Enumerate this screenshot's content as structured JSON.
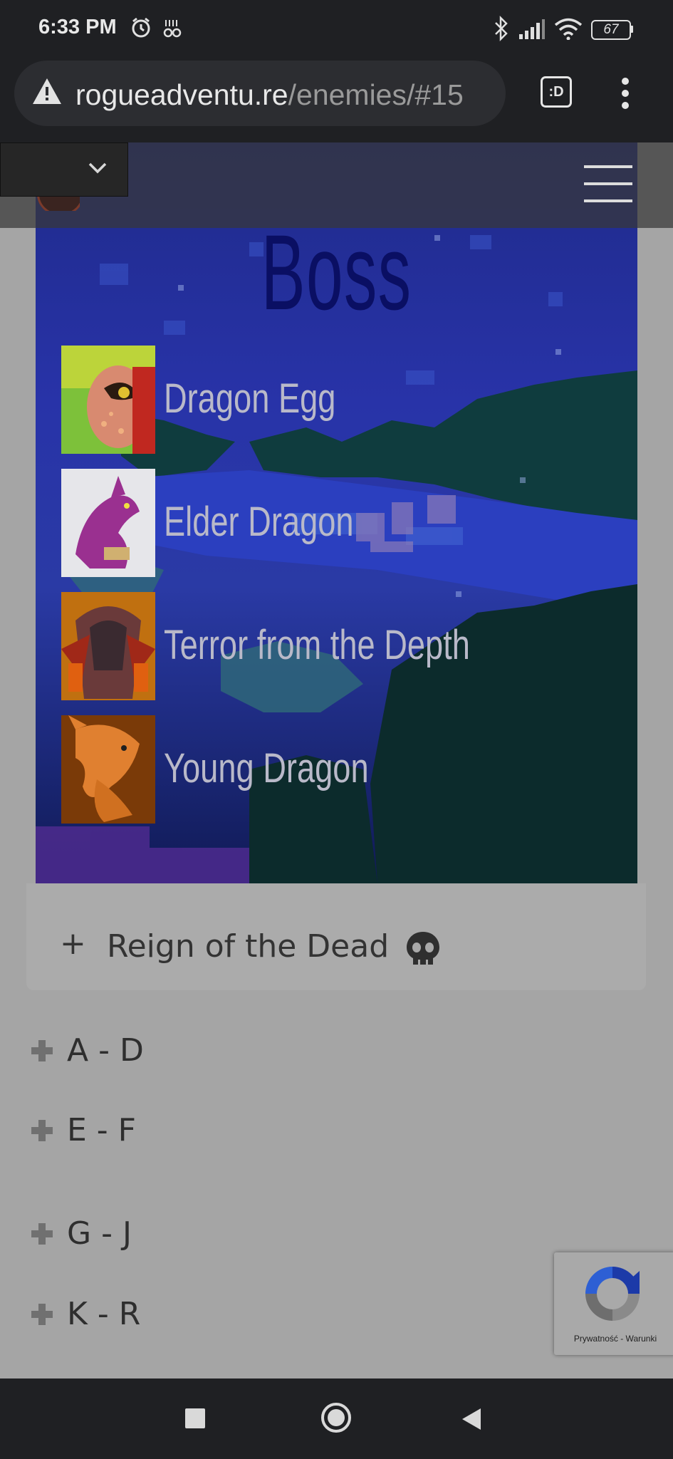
{
  "status_bar": {
    "time": "6:33 PM",
    "battery": "67",
    "icons": [
      "alarm-icon",
      "data-saver-icon",
      "bluetooth-icon",
      "signal-icon",
      "wifi-icon",
      "battery-icon"
    ]
  },
  "browser": {
    "url_domain": "rogueadventu.re",
    "url_path": "/enemies/#15",
    "tab_count": ":D",
    "icons": [
      "warning-icon",
      "tab-switcher-icon",
      "more-vert-icon"
    ]
  },
  "boss_panel": {
    "title": "Boss",
    "enemies": [
      {
        "name": "Dragon Egg"
      },
      {
        "name": "Elder Dragon"
      },
      {
        "name": "Terror from the Depth"
      },
      {
        "name": "Young Dragon"
      }
    ]
  },
  "accordion": {
    "reign_plus": "+",
    "reign_label": "Reign of the Dead",
    "categories": [
      {
        "label": "A - D"
      },
      {
        "label": "E - F"
      },
      {
        "label": "G - J"
      },
      {
        "label": "K - R"
      }
    ]
  },
  "recaptcha": {
    "links": "Prywatność - Warunki"
  },
  "colors": {
    "overlay_gray": "#a5a5a5",
    "boss_title": "#0a0f63",
    "system_bar": "#1f2023"
  }
}
